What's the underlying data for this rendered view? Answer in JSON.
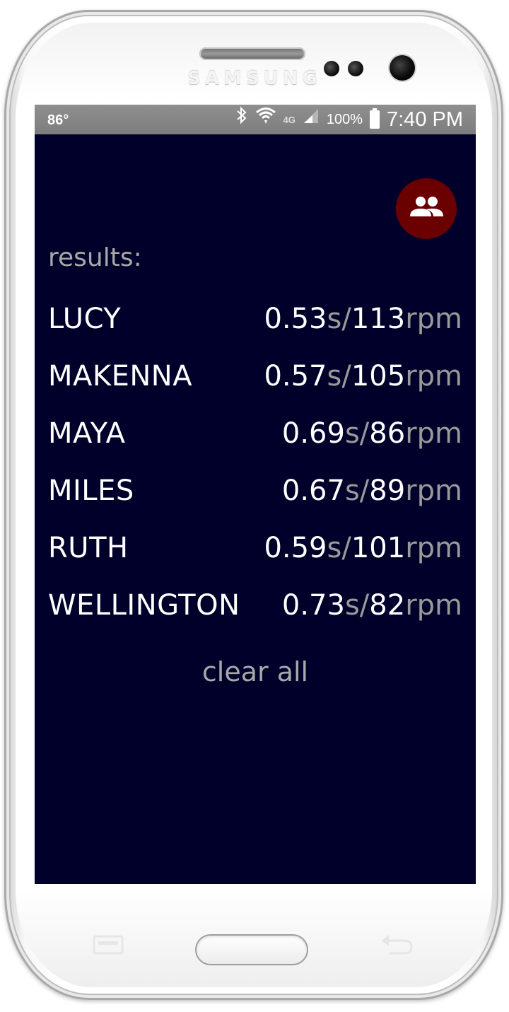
{
  "device": {
    "brand": "SAMSUNG"
  },
  "status_bar": {
    "temperature": "86°",
    "network": "4G",
    "battery_percent": "100%",
    "time": "7:40 PM"
  },
  "header": {
    "group_icon": "people-group-icon",
    "accent_color": "#6a0000"
  },
  "results": {
    "label": "results:",
    "rows": [
      {
        "name": "LUCY",
        "seconds": "0.53",
        "seconds_unit": "s",
        "separator": "/",
        "rpm": "113",
        "rpm_unit": "rpm"
      },
      {
        "name": "MAKENNA",
        "seconds": "0.57",
        "seconds_unit": "s",
        "separator": "/",
        "rpm": "105",
        "rpm_unit": "rpm"
      },
      {
        "name": "MAYA",
        "seconds": "0.69",
        "seconds_unit": "s",
        "separator": "/",
        "rpm": "86",
        "rpm_unit": "rpm"
      },
      {
        "name": "MILES",
        "seconds": "0.67",
        "seconds_unit": "s",
        "separator": "/",
        "rpm": "89",
        "rpm_unit": "rpm"
      },
      {
        "name": "RUTH",
        "seconds": "0.59",
        "seconds_unit": "s",
        "separator": "/",
        "rpm": "101",
        "rpm_unit": "rpm"
      },
      {
        "name": "WELLINGTON",
        "seconds": "0.73",
        "seconds_unit": "s",
        "separator": "/",
        "rpm": "82",
        "rpm_unit": "rpm"
      }
    ]
  },
  "actions": {
    "clear_all": "clear all"
  },
  "colors": {
    "background": "#00002a",
    "text_primary": "#ffffff",
    "text_muted": "#a8a8a8"
  }
}
